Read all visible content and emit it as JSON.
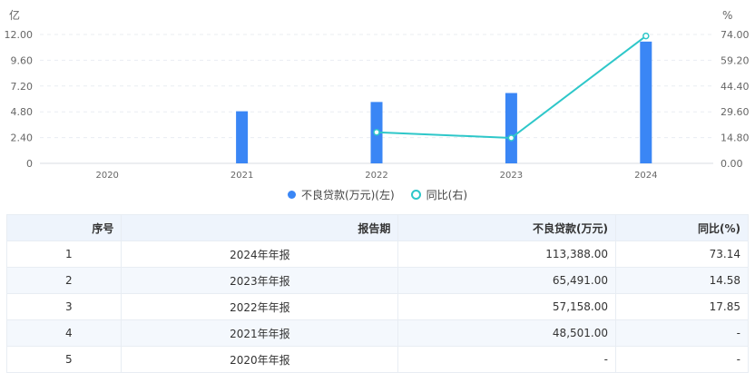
{
  "chart_data": {
    "type": "bar+line",
    "categories": [
      "2020",
      "2021",
      "2022",
      "2023",
      "2024"
    ],
    "y_left_unit": "亿",
    "y_right_unit": "%",
    "y_left_ticks": [
      "0",
      "2.40",
      "4.80",
      "7.20",
      "9.60",
      "12.00"
    ],
    "y_left_range": [
      0,
      12
    ],
    "y_right_ticks": [
      "0.00",
      "14.80",
      "29.60",
      "44.40",
      "59.20",
      "74.00"
    ],
    "y_right_range": [
      0,
      74
    ],
    "series": [
      {
        "name": "不良贷款(万元)(左)",
        "kind": "bar",
        "axis": "left",
        "color": "#3a86f5",
        "values": [
          null,
          4.8501,
          5.7158,
          6.5491,
          11.3388
        ]
      },
      {
        "name": "同比(右)",
        "kind": "line",
        "axis": "right",
        "color": "#2ec7c9",
        "values": [
          null,
          null,
          17.85,
          14.58,
          73.14
        ]
      }
    ],
    "grid": true,
    "legend_position": "bottom"
  },
  "legend": [
    {
      "label": "不良贷款(万元)(左)",
      "color": "#3a86f5"
    },
    {
      "label": "同比(右)",
      "color": "#2ec7c9"
    }
  ],
  "table": {
    "headers": [
      "序号",
      "报告期",
      "不良贷款(万元)",
      "同比(%)"
    ],
    "rows": [
      [
        "1",
        "2024年年报",
        "113,388.00",
        "73.14"
      ],
      [
        "2",
        "2023年年报",
        "65,491.00",
        "14.58"
      ],
      [
        "3",
        "2022年年报",
        "57,158.00",
        "17.85"
      ],
      [
        "4",
        "2021年年报",
        "48,501.00",
        "-"
      ],
      [
        "5",
        "2020年年报",
        "-",
        "-"
      ]
    ]
  }
}
